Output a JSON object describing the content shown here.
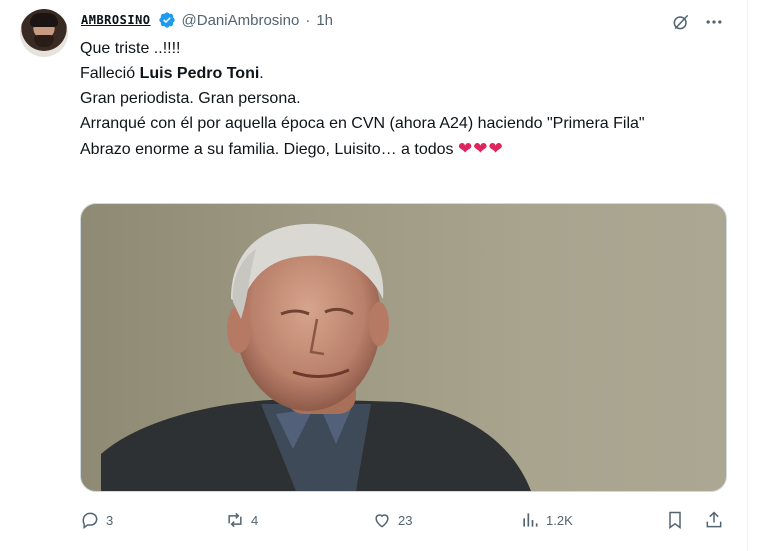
{
  "tweet": {
    "display_name": "AMBROSINO",
    "handle": "@DaniAmbrosino",
    "dot": "·",
    "time": "1h",
    "lines": {
      "l1": "Que triste ..!!!!",
      "l2_prefix": "Falleció ",
      "l2_bold": "Luis Pedro Toni",
      "l2_suffix": ".",
      "l3": "Gran periodista. Gran persona.",
      "l4": "Arranqué con él por aquella época  en CVN (ahora A24) haciendo \"Primera Fila\"",
      "l5": "Abrazo enorme a su familia. Diego, Luisito… a todos",
      "hearts": "❤❤❤"
    },
    "actions": {
      "replies": "3",
      "reposts": "4",
      "likes": "23",
      "views": "1.2K"
    }
  },
  "colors": {
    "accent": "#1d9bf0",
    "muted": "#536471",
    "heart": "#e0245e"
  }
}
